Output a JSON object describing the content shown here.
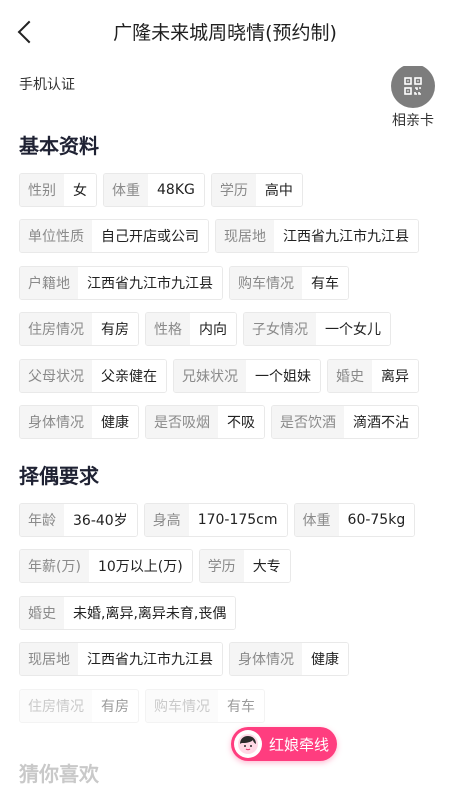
{
  "header": {
    "title": "广隆未来城周晓情(预约制)"
  },
  "profile": {
    "phone_auth": "手机认证"
  },
  "qr_card": {
    "label": "相亲卡"
  },
  "basic": {
    "title": "基本资料",
    "rows": [
      [
        {
          "k": "性别",
          "v": "女"
        },
        {
          "k": "体重",
          "v": "48KG"
        },
        {
          "k": "学历",
          "v": "高中"
        }
      ],
      [
        {
          "k": "单位性质",
          "v": "自己开店或公司"
        },
        {
          "k": "现居地",
          "v": "江西省九江市九江县"
        }
      ],
      [
        {
          "k": "户籍地",
          "v": "江西省九江市九江县"
        },
        {
          "k": "购车情况",
          "v": "有车"
        }
      ],
      [
        {
          "k": "住房情况",
          "v": "有房"
        },
        {
          "k": "性格",
          "v": "内向"
        },
        {
          "k": "子女情况",
          "v": "一个女儿"
        }
      ],
      [
        {
          "k": "父母状况",
          "v": "父亲健在"
        },
        {
          "k": "兄妹状况",
          "v": "一个姐妹"
        },
        {
          "k": "婚史",
          "v": "离异"
        }
      ],
      [
        {
          "k": "身体情况",
          "v": "健康"
        },
        {
          "k": "是否吸烟",
          "v": "不吸"
        },
        {
          "k": "是否饮酒",
          "v": "滴酒不沾"
        }
      ]
    ]
  },
  "requirements": {
    "title": "择偶要求",
    "rows": [
      [
        {
          "k": "年龄",
          "v": "36-40岁"
        },
        {
          "k": "身高",
          "v": "170-175cm"
        },
        {
          "k": "体重",
          "v": "60-75kg"
        }
      ],
      [
        {
          "k": "年薪(万)",
          "v": "10万以上(万)"
        },
        {
          "k": "学历",
          "v": "大专"
        }
      ],
      [
        {
          "k": "婚史",
          "v": "未婚,离异,离异未育,丧偶"
        }
      ],
      [
        {
          "k": "现居地",
          "v": "江西省九江市九江县"
        },
        {
          "k": "身体情况",
          "v": "健康"
        }
      ],
      [
        {
          "k": "住房情况",
          "v": "有房"
        },
        {
          "k": "购车情况",
          "v": "有车"
        }
      ]
    ]
  },
  "guess": {
    "title": "猜你喜欢"
  },
  "matchmaker": {
    "label": "红娘牵线"
  },
  "colors": {
    "accent_pink": "#ff3d7f",
    "qr_gray": "#7d7d7d"
  }
}
